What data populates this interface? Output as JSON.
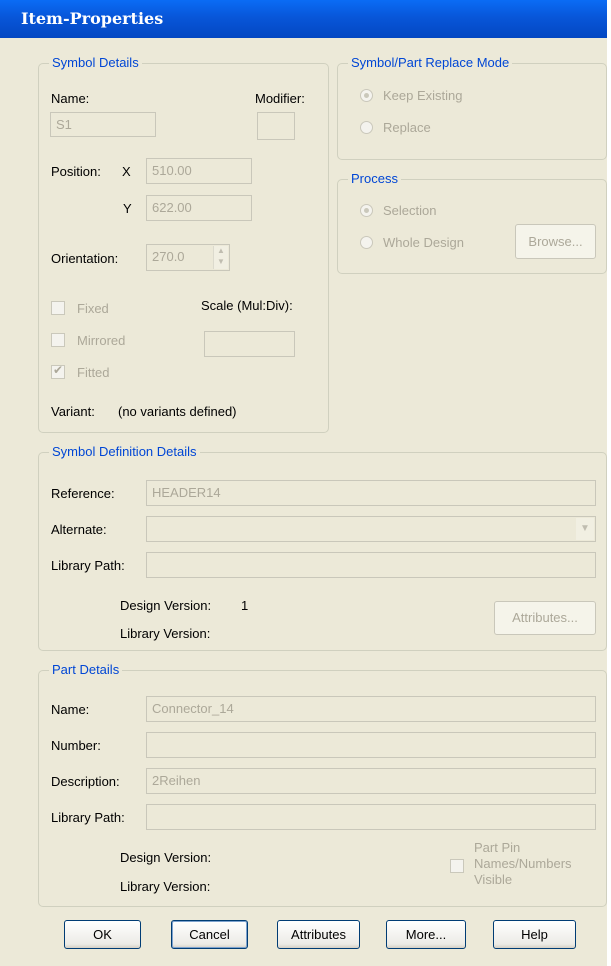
{
  "window": {
    "title": "Item-Properties"
  },
  "symbol_details": {
    "title": "Symbol Details",
    "name_label": "Name:",
    "name_value": "S1",
    "modifier_label": "Modifier:",
    "modifier_value": "",
    "position_label": "Position:",
    "x_label": "X",
    "x_value": "510.00",
    "y_label": "Y",
    "y_value": "622.00",
    "orientation_label": "Orientation:",
    "orientation_value": "270.0",
    "fixed_label": "Fixed",
    "mirrored_label": "Mirrored",
    "fitted_label": "Fitted",
    "scale_label": "Scale (Mul:Div):",
    "scale_value": "",
    "variant_label": "Variant:",
    "variant_value": "(no variants defined)"
  },
  "replace_mode": {
    "title": "Symbol/Part Replace Mode",
    "keep_existing_label": "Keep Existing",
    "replace_label": "Replace",
    "selected": "Keep Existing"
  },
  "process": {
    "title": "Process",
    "selection_label": "Selection",
    "whole_design_label": "Whole Design",
    "browse_label": "Browse...",
    "selected": "Selection"
  },
  "symbol_definition": {
    "title": "Symbol Definition Details",
    "reference_label": "Reference:",
    "reference_value": "HEADER14",
    "alternate_label": "Alternate:",
    "alternate_value": "",
    "library_path_label": "Library Path:",
    "library_path_value": "",
    "design_version_label": "Design Version:",
    "design_version_value": "1",
    "library_version_label": "Library Version:",
    "attributes_label": "Attributes..."
  },
  "part_details": {
    "title": "Part Details",
    "name_label": "Name:",
    "name_value": "Connector_14",
    "number_label": "Number:",
    "number_value": "",
    "description_label": "Description:",
    "description_value": "2Reihen",
    "library_path_label": "Library Path:",
    "library_path_value": "",
    "design_version_label": "Design Version:",
    "library_version_label": "Library Version:",
    "pin_visible_line1": "Part Pin",
    "pin_visible_line2": "Names/Numbers",
    "pin_visible_line3": "Visible"
  },
  "buttons": {
    "ok": "OK",
    "cancel": "Cancel",
    "attributes": "Attributes",
    "more": "More...",
    "help": "Help"
  },
  "colors": {
    "titlebar": "#0856d9",
    "dialog_bg": "#ece9d8",
    "group_title": "#0046d5",
    "disabled_text": "#aca899"
  }
}
